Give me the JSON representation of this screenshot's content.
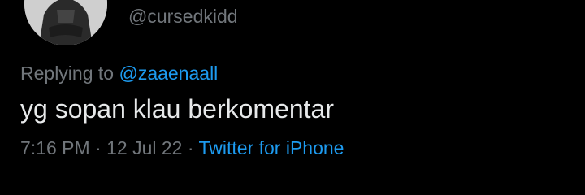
{
  "tweet": {
    "handle": "@cursedkidd",
    "replying_prefix": "Replying to ",
    "replying_to": "@zaaenaall",
    "text": "yg sopan klau berkomentar",
    "time": "7:16 PM",
    "separator": " · ",
    "date": "12 Jul 22",
    "source": "Twitter for iPhone"
  },
  "colors": {
    "background": "#000000",
    "text": "#e7e9ea",
    "muted": "#71767b",
    "link": "#1d9bf0",
    "divider": "#2f3336"
  },
  "icons": {
    "avatar": "profile-avatar"
  }
}
